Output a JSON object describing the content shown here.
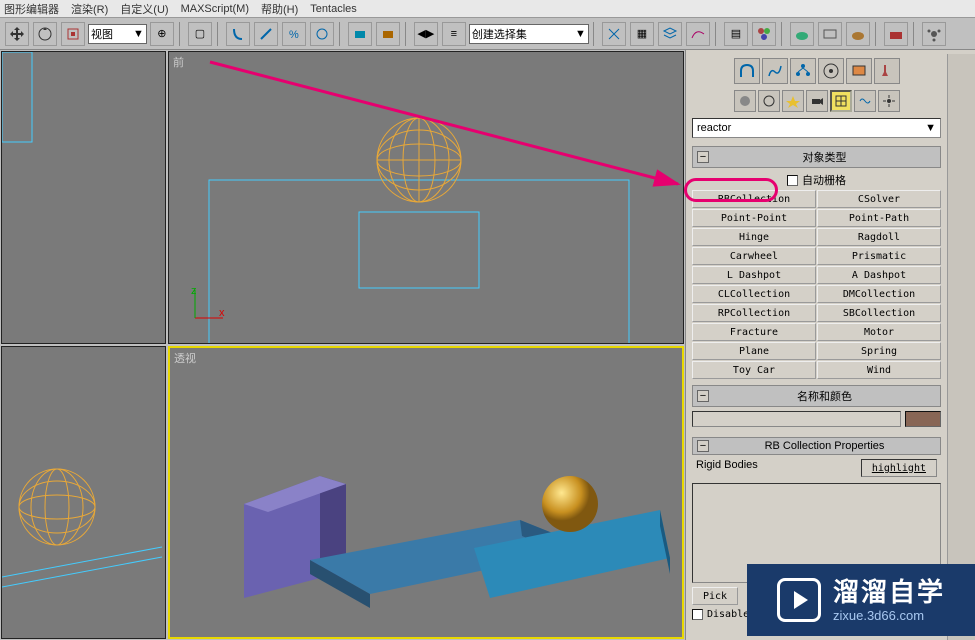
{
  "menu": {
    "items": [
      "图形编辑器",
      "渲染(R)",
      "自定义(U)",
      "MAXScript(M)",
      "帮助(H)",
      "Tentacles"
    ]
  },
  "toolbar": {
    "view_combo": "视图",
    "sel_set_combo": "创建选择集"
  },
  "viewports": {
    "front_label": "前",
    "persp_label": "透视",
    "axis_x": "x",
    "axis_z": "z"
  },
  "panel": {
    "category_combo": "reactor",
    "rollout_obj_types": "对象类型",
    "autogrid_label": "自动栅格",
    "buttons": [
      [
        "RBCollection",
        "CSolver"
      ],
      [
        "Point-Point",
        "Point-Path"
      ],
      [
        "Hinge",
        "Ragdoll"
      ],
      [
        "Carwheel",
        "Prismatic"
      ],
      [
        "L Dashpot",
        "A Dashpot"
      ],
      [
        "CLCollection",
        "DMCollection"
      ],
      [
        "RPCollection",
        "SBCollection"
      ],
      [
        "Fracture",
        "Motor"
      ],
      [
        "Plane",
        "Spring"
      ],
      [
        "Toy Car",
        "Wind"
      ]
    ],
    "rollout_name_color": "名称和颜色",
    "rollout_rb_props": "RB Collection Properties",
    "rigid_bodies_label": "Rigid Bodies",
    "highlight_label": "highlight",
    "pick_label": "Pick",
    "disabled_label": "Disabled"
  },
  "watermark": {
    "big": "溜溜自学",
    "url": "zixue.3d66.com"
  }
}
